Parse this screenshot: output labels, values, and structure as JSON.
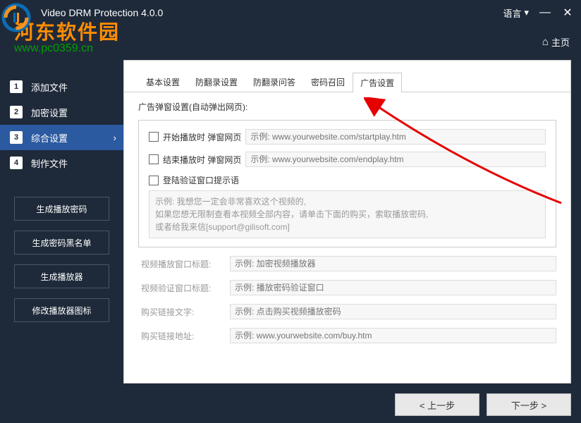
{
  "titlebar": {
    "app_title": "Video DRM Protection 4.0.0",
    "lang_label": "语言"
  },
  "watermark": {
    "cn": "河东软件园",
    "url": "www.pc0359.cn"
  },
  "home": {
    "label": "主页"
  },
  "sidebar": {
    "items": [
      {
        "num": "1",
        "label": "添加文件"
      },
      {
        "num": "2",
        "label": "加密设置"
      },
      {
        "num": "3",
        "label": "综合设置"
      },
      {
        "num": "4",
        "label": "制作文件"
      }
    ],
    "buttons": [
      "生成播放密码",
      "生成密码黑名单",
      "生成播放器",
      "修改播放器图标"
    ]
  },
  "tabs": [
    "基本设置",
    "防翻录设置",
    "防翻录问答",
    "密码召回",
    "广告设置"
  ],
  "panel": {
    "section_title": "广告弹窗设置(自动弹出网页):",
    "cb1_label": "开始播放时 弹窗网页",
    "cb1_placeholder": "示例: www.yourwebsite.com/startplay.htm",
    "cb2_label": "结束播放时 弹窗网页",
    "cb2_placeholder": "示例: www.yourwebsite.com/endplay.htm",
    "cb3_label": "登陆验证窗口提示语",
    "hint_line1": "示例: 我想您一定会非常喜欢这个视频的,",
    "hint_line2": "如果您想无限制查看本视频全部内容，请单击下面的购买，索取播放密码,",
    "hint_line3": "或者给我来信[support@gilisoft.com]",
    "form1_label": "视频播放窗口标题:",
    "form1_placeholder": "示例: 加密视频播放器",
    "form2_label": "视频验证窗口标题:",
    "form2_placeholder": "示例: 播放密码验证窗口",
    "form3_label": "购买链接文字:",
    "form3_placeholder": "示例: 点击购买视频播放密码",
    "form4_label": "购买链接地址:",
    "form4_placeholder": "示例: www.yourwebsite.com/buy.htm"
  },
  "footer": {
    "prev": "< 上一步",
    "next": "下一步 >"
  }
}
